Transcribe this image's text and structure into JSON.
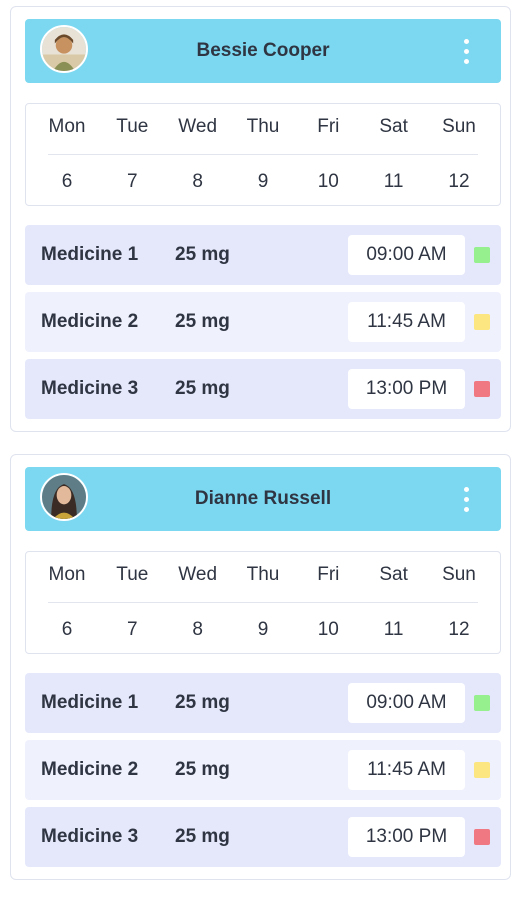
{
  "patients": [
    {
      "name": "Bessie Cooper",
      "days": [
        "Mon",
        "Tue",
        "Wed",
        "Thu",
        "Fri",
        "Sat",
        "Sun"
      ],
      "dates": [
        "6",
        "7",
        "8",
        "9",
        "10",
        "11",
        "12"
      ],
      "medicines": [
        {
          "name": "Medicine 1",
          "dose": "25 mg",
          "time": "09:00 AM",
          "status_color": "#95f08d"
        },
        {
          "name": "Medicine 2",
          "dose": "25 mg",
          "time": "11:45 AM",
          "status_color": "#fbe682"
        },
        {
          "name": "Medicine 3",
          "dose": "25 mg",
          "time": "13:00 PM",
          "status_color": "#ef7882"
        }
      ]
    },
    {
      "name": "Dianne Russell",
      "days": [
        "Mon",
        "Tue",
        "Wed",
        "Thu",
        "Fri",
        "Sat",
        "Sun"
      ],
      "dates": [
        "6",
        "7",
        "8",
        "9",
        "10",
        "11",
        "12"
      ],
      "medicines": [
        {
          "name": "Medicine 1",
          "dose": "25 mg",
          "time": "09:00 AM",
          "status_color": "#95f08d"
        },
        {
          "name": "Medicine 2",
          "dose": "25 mg",
          "time": "11:45 AM",
          "status_color": "#fbe682"
        },
        {
          "name": "Medicine 3",
          "dose": "25 mg",
          "time": "13:00 PM",
          "status_color": "#ef7882"
        }
      ]
    }
  ],
  "colors": {
    "header_bg": "#7bd8f0",
    "row_bg": "#e5e8fb",
    "row_alt_bg": "#eff1fd"
  },
  "icons": {
    "avatar": "user-avatar-photo",
    "menu": "more-vertical-icon"
  }
}
